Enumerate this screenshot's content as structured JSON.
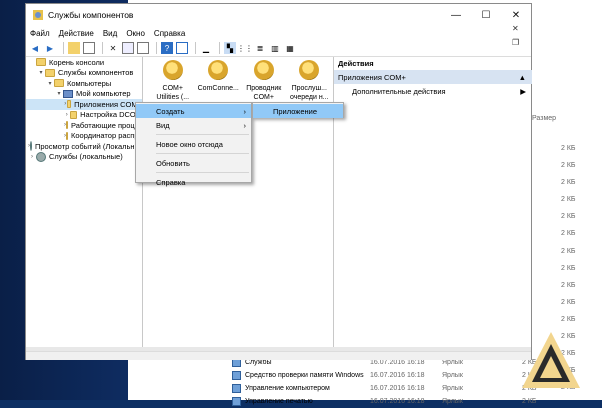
{
  "window": {
    "title": "Службы компонентов",
    "controls": {
      "minimize": "—",
      "maximize": "☐",
      "close": "✕"
    },
    "inner_close": "✕",
    "inner_restore": "❐"
  },
  "menu": [
    "Файл",
    "Действие",
    "Вид",
    "Окно",
    "Справка"
  ],
  "tree": [
    {
      "label": "Корень консоли",
      "icon": "folder",
      "indent": 0,
      "arrow": ""
    },
    {
      "label": "Службы компонентов",
      "icon": "folder",
      "indent": 1,
      "arrow": "▾"
    },
    {
      "label": "Компьютеры",
      "icon": "folder",
      "indent": 2,
      "arrow": "▾"
    },
    {
      "label": "Мой компьютер",
      "icon": "computer",
      "indent": 3,
      "arrow": "▾"
    },
    {
      "label": "Приложения COM+",
      "icon": "folder",
      "indent": 4,
      "arrow": "›"
    },
    {
      "label": "Настройка DCOM",
      "icon": "folder",
      "indent": 4,
      "arrow": "›"
    },
    {
      "label": "Работающие процессы",
      "icon": "folder",
      "indent": 4,
      "arrow": "›"
    },
    {
      "label": "Координатор распределенных транзакций",
      "icon": "folder",
      "indent": 4,
      "arrow": "›"
    },
    {
      "label": "Просмотр событий (Локальный)",
      "icon": "gear",
      "indent": 0,
      "arrow": "›"
    },
    {
      "label": "Службы (локальные)",
      "icon": "gear",
      "indent": 0,
      "arrow": "›"
    }
  ],
  "items": [
    {
      "line1": "COM+",
      "line2": "Utilities (..."
    },
    {
      "line1": "ComConne...",
      "line2": ""
    },
    {
      "line1": "Проводник",
      "line2": "COM+"
    },
    {
      "line1": "Прослуш...",
      "line2": "очереди н..."
    }
  ],
  "actions": {
    "header": "Действия",
    "selected": "Приложения COM+",
    "selected_arrow": "▲",
    "more": "Дополнительные действия",
    "more_arrow": "▶"
  },
  "context_menu": [
    {
      "label": "Создать",
      "arrow": "›",
      "highlighted": true
    },
    {
      "label": "Вид",
      "arrow": "›",
      "highlighted": false
    },
    {
      "label": "Новое окно отсюда",
      "arrow": "",
      "highlighted": false
    },
    {
      "label": "Обновить",
      "arrow": "",
      "highlighted": false
    },
    {
      "label": "Справка",
      "arrow": "",
      "highlighted": false
    }
  ],
  "submenu": {
    "label": "Приложение"
  },
  "background": {
    "size_header": "Размер",
    "sizes": [
      "2 КБ",
      "2 КБ",
      "2 КБ",
      "2 КБ",
      "2 КБ",
      "2 КБ",
      "2 КБ",
      "2 КБ",
      "2 КБ",
      "2 КБ",
      "2 КБ",
      "2 КБ",
      "2 КБ",
      "2 КБ",
      "2 КБ"
    ],
    "rows": [
      {
        "name": "Службы",
        "date": "16.07.2016 16:18",
        "type": "Ярлык",
        "size": "2 КБ"
      },
      {
        "name": "Средство проверки памяти Windows",
        "date": "16.07.2016 16:18",
        "type": "Ярлык",
        "size": "2 КБ"
      },
      {
        "name": "Управление компьютером",
        "date": "16.07.2016 16:18",
        "type": "Ярлык",
        "size": "2 КБ"
      },
      {
        "name": "Управление печатью",
        "date": "16.07.2016 16:18",
        "type": "Ярлык",
        "size": "2 КБ"
      }
    ]
  },
  "logo_text": "AV"
}
